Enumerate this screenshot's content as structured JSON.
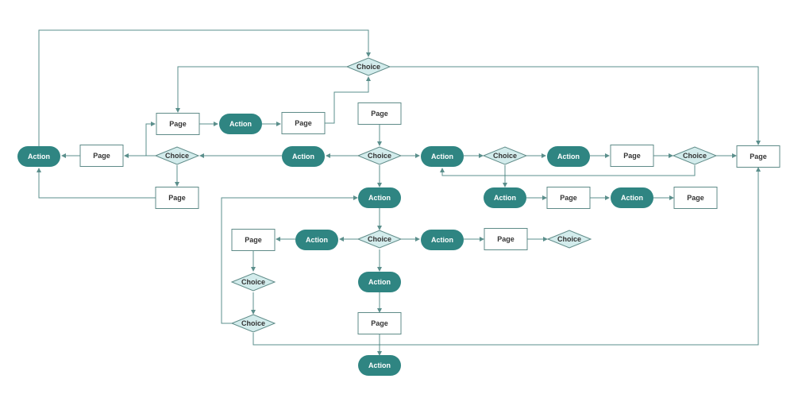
{
  "diagram": {
    "type": "flowchart",
    "colors": {
      "action_fill": "#2f8582",
      "action_text": "#ffffff",
      "page_fill": "#ffffff",
      "page_stroke": "#5f8b88",
      "page_text": "#333333",
      "choice_fill": "#d3ecec",
      "choice_stroke": "#5f8b88",
      "choice_text": "#333333",
      "edge": "#3f7c79"
    },
    "nodes": [
      {
        "id": "n1",
        "kind": "choice",
        "label": "Choice"
      },
      {
        "id": "n2",
        "kind": "page",
        "label": "Page"
      },
      {
        "id": "n3",
        "kind": "action",
        "label": "Action"
      },
      {
        "id": "n4",
        "kind": "page",
        "label": "Page"
      },
      {
        "id": "n5",
        "kind": "page",
        "label": "Page"
      },
      {
        "id": "n6",
        "kind": "action",
        "label": "Action"
      },
      {
        "id": "n7",
        "kind": "page",
        "label": "Page"
      },
      {
        "id": "n8",
        "kind": "choice",
        "label": "Choice"
      },
      {
        "id": "n9",
        "kind": "action",
        "label": "Action"
      },
      {
        "id": "n10",
        "kind": "choice",
        "label": "Choice"
      },
      {
        "id": "n11",
        "kind": "action",
        "label": "Action"
      },
      {
        "id": "n12",
        "kind": "choice",
        "label": "Choice"
      },
      {
        "id": "n13",
        "kind": "action",
        "label": "Action"
      },
      {
        "id": "n14",
        "kind": "page",
        "label": "Page"
      },
      {
        "id": "n15",
        "kind": "choice",
        "label": "Choice"
      },
      {
        "id": "n16",
        "kind": "page",
        "label": "Page"
      },
      {
        "id": "n17",
        "kind": "page",
        "label": "Page"
      },
      {
        "id": "n18",
        "kind": "action",
        "label": "Action"
      },
      {
        "id": "n19",
        "kind": "action",
        "label": "Action"
      },
      {
        "id": "n20",
        "kind": "page",
        "label": "Page"
      },
      {
        "id": "n21",
        "kind": "action",
        "label": "Action"
      },
      {
        "id": "n22",
        "kind": "page",
        "label": "Page"
      },
      {
        "id": "n23",
        "kind": "page",
        "label": "Page"
      },
      {
        "id": "n24",
        "kind": "action",
        "label": "Action"
      },
      {
        "id": "n25",
        "kind": "choice",
        "label": "Choice"
      },
      {
        "id": "n26",
        "kind": "action",
        "label": "Action"
      },
      {
        "id": "n27",
        "kind": "page",
        "label": "Page"
      },
      {
        "id": "n28",
        "kind": "choice",
        "label": "Choice"
      },
      {
        "id": "n29",
        "kind": "action",
        "label": "Action"
      },
      {
        "id": "n30",
        "kind": "action",
        "label": "Action"
      },
      {
        "id": "n31",
        "kind": "choice",
        "label": "Choice"
      },
      {
        "id": "n32",
        "kind": "page",
        "label": "Page"
      },
      {
        "id": "n33",
        "kind": "choice",
        "label": "Choice"
      }
    ],
    "edges": [
      {
        "from": "n5",
        "to": "n1"
      },
      {
        "from": "n1",
        "to": "n2"
      },
      {
        "from": "n1",
        "to": "n16"
      },
      {
        "from": "n2",
        "to": "n3"
      },
      {
        "from": "n3",
        "to": "n4"
      },
      {
        "from": "n4",
        "to": "n1"
      },
      {
        "from": "n17",
        "to": "n10"
      },
      {
        "from": "n10",
        "to": "n9"
      },
      {
        "from": "n9",
        "to": "n8"
      },
      {
        "from": "n8",
        "to": "n7"
      },
      {
        "from": "n8",
        "to": "n2"
      },
      {
        "from": "n8",
        "to": "n23"
      },
      {
        "from": "n7",
        "to": "n6"
      },
      {
        "from": "n23",
        "to": "n6"
      },
      {
        "from": "n6",
        "to": "n1"
      },
      {
        "from": "n10",
        "to": "n11"
      },
      {
        "from": "n11",
        "to": "n12"
      },
      {
        "from": "n12",
        "to": "n13"
      },
      {
        "from": "n13",
        "to": "n14"
      },
      {
        "from": "n14",
        "to": "n15"
      },
      {
        "from": "n15",
        "to": "n16"
      },
      {
        "from": "n15",
        "to": "n11"
      },
      {
        "from": "n12",
        "to": "n18"
      },
      {
        "from": "n18",
        "to": "n20"
      },
      {
        "from": "n20",
        "to": "n21"
      },
      {
        "from": "n21",
        "to": "n22"
      },
      {
        "from": "n10",
        "to": "n24"
      },
      {
        "from": "n24",
        "to": "n25"
      },
      {
        "from": "n25",
        "to": "n26"
      },
      {
        "from": "n26",
        "to": "n27"
      },
      {
        "from": "n27",
        "to": "n28"
      },
      {
        "from": "n25",
        "to": "n29"
      },
      {
        "from": "n29",
        "to": "n32"
      },
      {
        "from": "n25",
        "to": "n30"
      },
      {
        "from": "n30",
        "to": "n33"
      },
      {
        "from": "n33",
        "to": "n31"
      },
      {
        "from": "n31",
        "to": "n24"
      },
      {
        "from": "n31",
        "to": "n16"
      },
      {
        "from": "n32",
        "to": "n33"
      }
    ]
  }
}
